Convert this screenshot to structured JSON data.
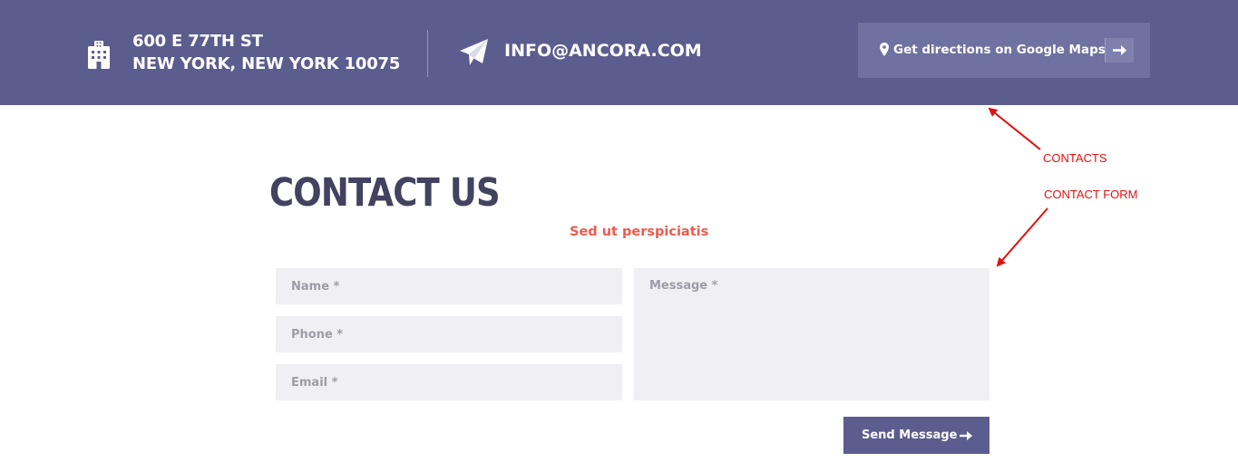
{
  "header": {
    "address_line1": "600 E 77TH ST",
    "address_line2": "NEW YORK, NEW YORK 10075",
    "email": "INFO@ANCORA.COM",
    "maps_button_label": "Get directions on Google Maps",
    "icons": [
      "building-icon",
      "paper-plane-icon",
      "map-pin-icon",
      "arrow-right-icon"
    ]
  },
  "contact": {
    "title": "CONTACT US",
    "subtitle": "Sed ut perspiciatis",
    "name_placeholder": "Name *",
    "phone_placeholder": "Phone *",
    "email_placeholder": "Email *",
    "message_placeholder": "Message *",
    "send_label": "Send Message"
  },
  "annotations": {
    "contacts": "CONTACTS",
    "contact_form": "CONTACT FORM"
  },
  "colors": {
    "header_bg": "#5b5d8f",
    "button_bg": "#6f71a0",
    "title": "#434260",
    "subtitle": "#ef5a4c",
    "field_bg": "#f0f0f4",
    "annotation": "#e31010"
  }
}
